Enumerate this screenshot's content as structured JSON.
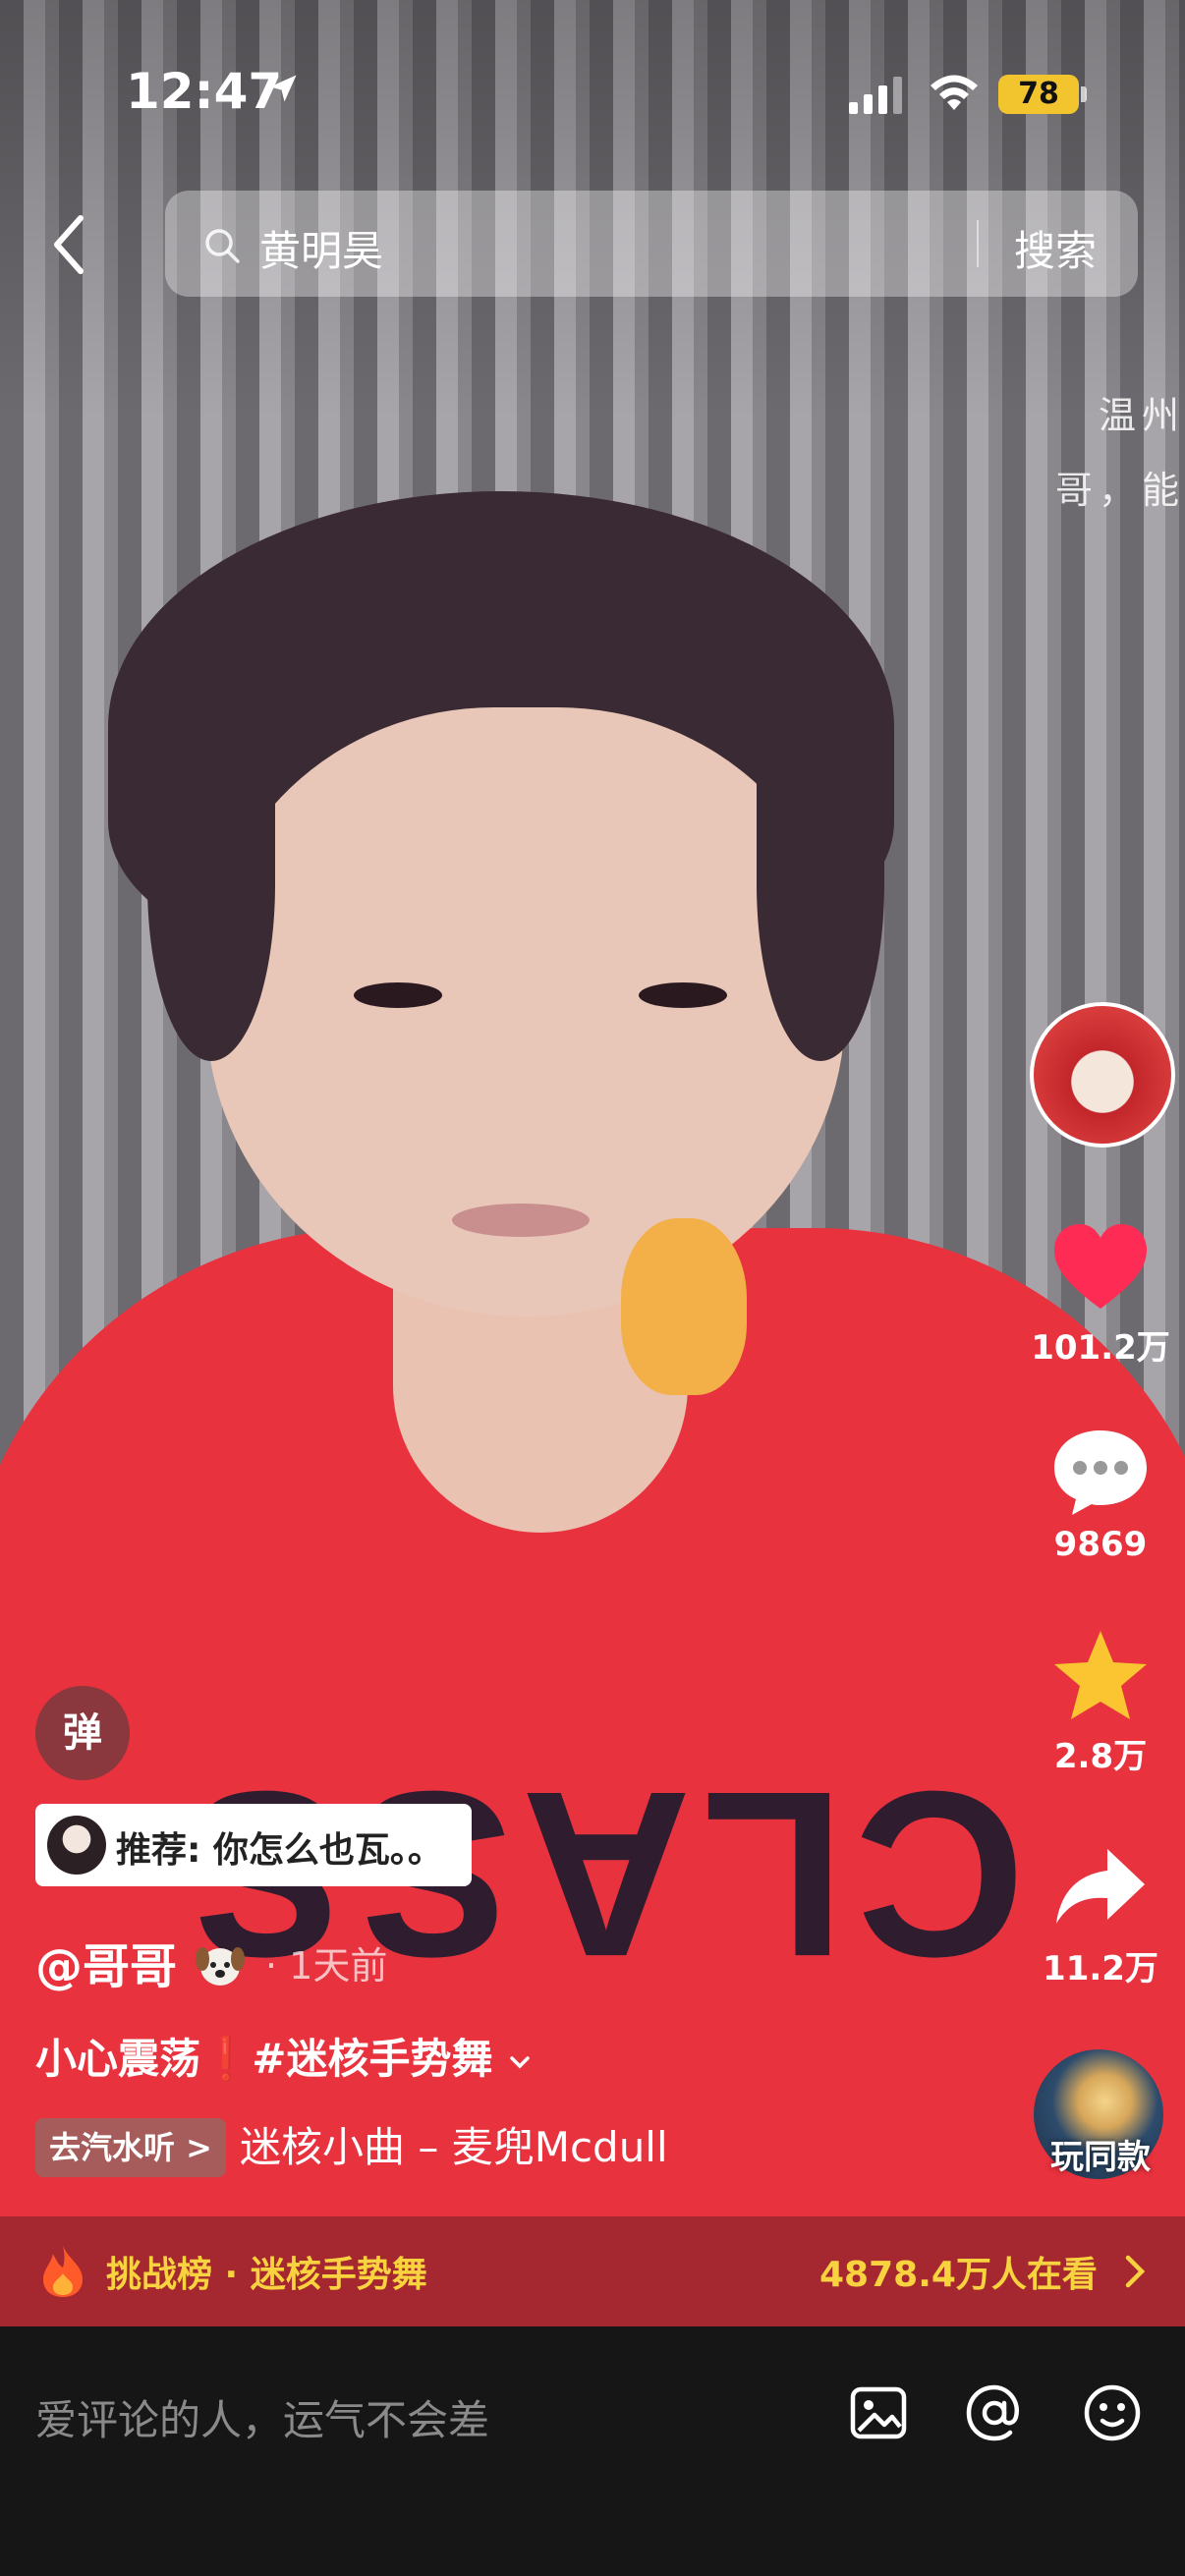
{
  "status_bar": {
    "time": "12:47",
    "battery": "78"
  },
  "search": {
    "query": "黄明昊",
    "button_label": "搜索"
  },
  "live_comments": [
    "温州",
    "哥，能"
  ],
  "actions": {
    "likes": "101.2万",
    "comments": "9869",
    "favorites": "2.8万",
    "shares": "11.2万"
  },
  "danmu_label": "弹",
  "recommendation": {
    "label": "推荐: 你怎么也瓦。。"
  },
  "post": {
    "author": "@哥哥",
    "time_ago": "1天前",
    "description": "小心震荡❗#迷核手势舞"
  },
  "music": {
    "tag": "去汽水听 >",
    "title": "迷核小曲 – 麦兜Mcdull"
  },
  "play_same_label": "玩同款",
  "challenge": {
    "label": "挑战榜 · 迷核手势舞",
    "viewers": "4878.4万人在看"
  },
  "comment_input": {
    "placeholder": "爱评论的人，运气不会差"
  },
  "shirt_text": "CLASS"
}
